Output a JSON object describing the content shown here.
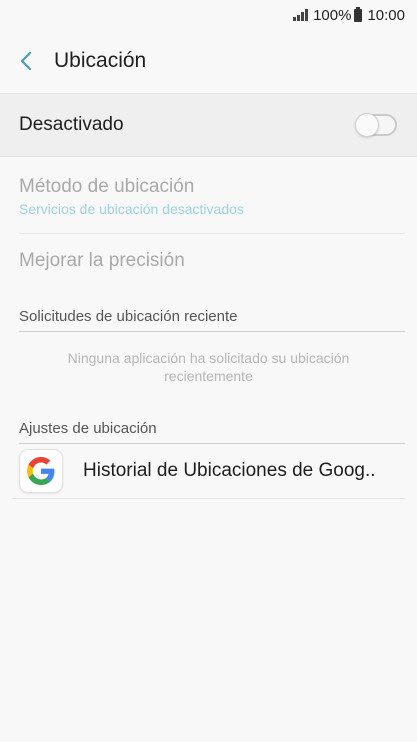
{
  "status_bar": {
    "battery_percent": "100%",
    "time": "10:00"
  },
  "header": {
    "title": "Ubicación"
  },
  "master_switch": {
    "label": "Desactivado",
    "enabled": false
  },
  "settings": {
    "method_title": "Método de ubicación",
    "method_subtitle": "Servicios de ubicación desactivados",
    "precision_title": "Mejorar la precisión"
  },
  "recent_requests": {
    "header": "Solicitudes de ubicación reciente",
    "empty_message": "Ninguna aplicación ha solicitado su ubicación recientemente"
  },
  "location_settings": {
    "header": "Ajustes de ubicación",
    "items": [
      {
        "label": "Historial de Ubicaciones de Goog..",
        "icon": "google-icon"
      }
    ]
  },
  "colors": {
    "accent": "#4a9bbd",
    "disabled_text": "#a9a9a9",
    "subtitle_disabled": "#9cd2e6"
  }
}
